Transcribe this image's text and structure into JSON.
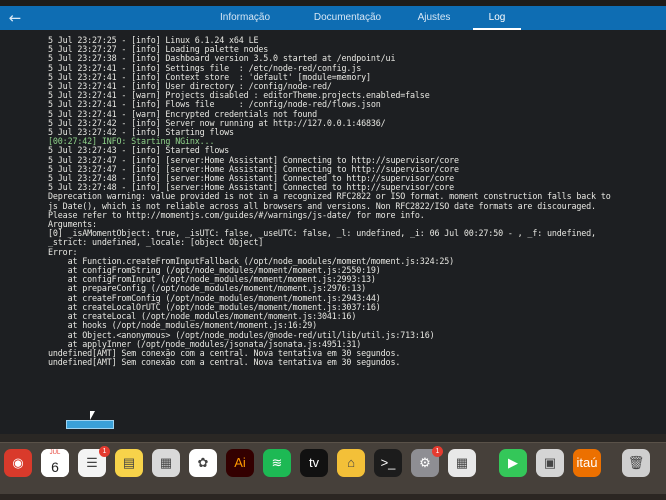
{
  "header": {
    "back_label": "←",
    "tabs": [
      {
        "label": "Informação",
        "active": false
      },
      {
        "label": "Documentação",
        "active": false
      },
      {
        "label": "Ajustes",
        "active": false
      },
      {
        "label": "Log",
        "active": true
      }
    ]
  },
  "log": {
    "lines": [
      "5 Jul 23:27:25 - [info] Linux 6.1.24 x64 LE",
      "5 Jul 23:27:27 - [info] Loading palette nodes",
      "5 Jul 23:27:38 - [info] Dashboard version 3.5.0 started at /endpoint/ui",
      "5 Jul 23:27:41 - [info] Settings file  : /etc/node-red/config.js",
      "5 Jul 23:27:41 - [info] Context store  : 'default' [module=memory]",
      "5 Jul 23:27:41 - [info] User directory : /config/node-red/",
      "5 Jul 23:27:41 - [warn] Projects disabled : editorTheme.projects.enabled=false",
      "5 Jul 23:27:41 - [info] Flows file     : /config/node-red/flows.json",
      "5 Jul 23:27:41 - [warn] Encrypted credentials not found",
      "5 Jul 23:27:42 - [info] Server now running at http://127.0.0.1:46836/",
      "5 Jul 23:27:42 - [info] Starting flows",
      "[00:27:42] INFO: Starting NGinx...",
      "5 Jul 23:27:43 - [info] Started flows",
      "5 Jul 23:27:47 - [info] [server:Home Assistant] Connecting to http://supervisor/core",
      "5 Jul 23:27:47 - [info] [server:Home Assistant] Connecting to http://supervisor/core",
      "5 Jul 23:27:48 - [info] [server:Home Assistant] Connected to http://supervisor/core",
      "5 Jul 23:27:48 - [info] [server:Home Assistant] Connected to http://supervisor/core",
      "Deprecation warning: value provided is not in a recognized RFC2822 or ISO format. moment construction falls back to",
      "js Date(), which is not reliable across all browsers and versions. Non RFC2822/ISO date formats are discouraged.",
      "Please refer to http://momentjs.com/guides/#/warnings/js-date/ for more info.",
      "Arguments:",
      "[0] _isAMomentObject: true, _isUTC: false, _useUTC: false, _l: undefined, _i: 06 Jul 00:27:50 - , _f: undefined,",
      "_strict: undefined, _locale: [object Object]",
      "Error:",
      "    at Function.createFromInputFallback (/opt/node_modules/moment/moment.js:324:25)",
      "    at configFromString (/opt/node_modules/moment/moment.js:2550:19)",
      "    at configFromInput (/opt/node_modules/moment/moment.js:2993:13)",
      "    at prepareConfig (/opt/node_modules/moment/moment.js:2976:13)",
      "    at createFromConfig (/opt/node_modules/moment/moment.js:2943:44)",
      "    at createLocalOrUTC (/opt/node_modules/moment/moment.js:3037:16)",
      "    at createLocal (/opt/node_modules/moment/moment.js:3041:16)",
      "    at hooks (/opt/node_modules/moment/moment.js:16:29)",
      "    at Object.<anonymous> (/opt/node_modules/@node-red/util/lib/util.js:713:16)",
      "    at applyInner (/opt/node_modules/jsonata/jsonata.js:4951:31)",
      "undefined[AMT] Sem conexão com a central. Nova tentativa em 30 segundos.",
      "undefined[AMT] Sem conexão com a central. Nova tentativa em 30 segundos."
    ],
    "highlight_line_index": 11
  },
  "dock": {
    "calendar": {
      "month": "JUL",
      "day": "6"
    },
    "icons": [
      {
        "name": "chrome-icon",
        "glyph": "◉",
        "color": "#d93a2b"
      },
      {
        "name": "calendar-icon",
        "glyph": "",
        "color": "#ffffff"
      },
      {
        "name": "reminders-icon",
        "glyph": "☰",
        "color": "#f4f4f4"
      },
      {
        "name": "notes-icon",
        "glyph": "▤",
        "color": "#f7d34a"
      },
      {
        "name": "calculator-icon",
        "glyph": "▦",
        "color": "#d9d9d9"
      },
      {
        "name": "photos-icon",
        "glyph": "✿",
        "color": "#ffffff"
      },
      {
        "name": "illustrator-icon",
        "glyph": "Ai",
        "color": "#330000"
      },
      {
        "name": "spotify-icon",
        "glyph": "≋",
        "color": "#1db954"
      },
      {
        "name": "apple-tv-icon",
        "glyph": "tv",
        "color": "#111111"
      },
      {
        "name": "home-icon",
        "glyph": "⌂",
        "color": "#f3c038"
      },
      {
        "name": "terminal-icon",
        "glyph": ">_",
        "color": "#1c1c1c"
      },
      {
        "name": "system-settings-icon",
        "glyph": "⚙",
        "color": "#8e8e93"
      },
      {
        "name": "launchpad-icon",
        "glyph": "▦",
        "color": "#e8e8e8"
      },
      {
        "name": "facetime-icon",
        "glyph": "▶",
        "color": "#34c759"
      },
      {
        "name": "preview-icon",
        "glyph": "▣",
        "color": "#d5d5d5"
      },
      {
        "name": "itau-icon",
        "glyph": "itaú",
        "color": "#ec7000"
      },
      {
        "name": "trash-icon",
        "glyph": "🗑",
        "color": "#cfcfcf"
      }
    ],
    "badges": {
      "reminders": "1",
      "system_settings": "1"
    }
  }
}
